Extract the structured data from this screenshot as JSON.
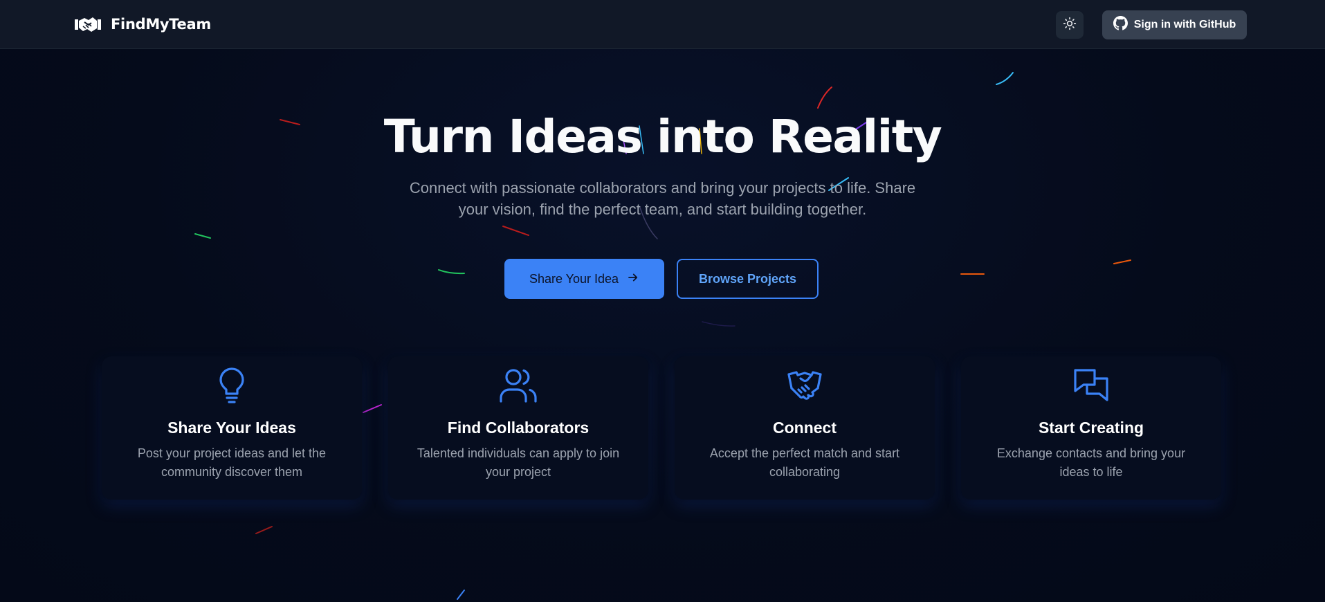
{
  "header": {
    "brand": "FindMyTeam",
    "theme_icon": "sun-icon",
    "github_icon": "github-icon",
    "signin_label": "Sign in with GitHub"
  },
  "hero": {
    "title": "Turn Ideas into Reality",
    "subtitle": "Connect with passionate collaborators and bring your projects to life. Share your vision, find the perfect team, and start building together.",
    "primary_cta": "Share Your Idea",
    "primary_cta_icon": "arrow-right-icon",
    "secondary_cta": "Browse Projects"
  },
  "features": [
    {
      "icon": "lightbulb-icon",
      "title": "Share Your Ideas",
      "desc": "Post your project ideas and let the community discover them"
    },
    {
      "icon": "users-icon",
      "title": "Find Collaborators",
      "desc": "Talented individuals can apply to join your project"
    },
    {
      "icon": "handshake-icon",
      "title": "Connect",
      "desc": "Accept the perfect match and start collaborating"
    },
    {
      "icon": "chat-bubbles-icon",
      "title": "Start Creating",
      "desc": "Exchange contacts and bring your ideas to life"
    }
  ],
  "colors": {
    "accent": "#3b82f6",
    "header_bg": "#111827",
    "page_bg": "#050b1b",
    "muted_text": "#9ca3af"
  }
}
